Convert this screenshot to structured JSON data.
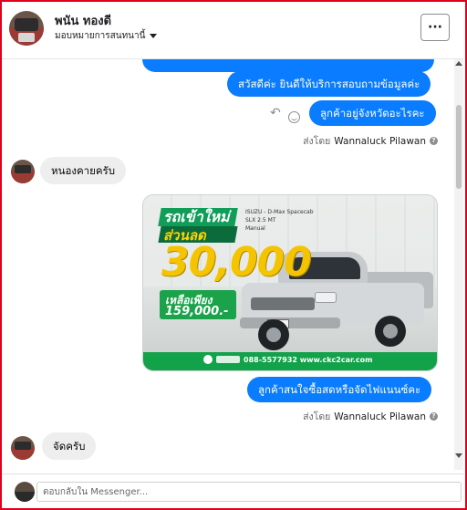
{
  "header": {
    "name": "พนัน ทองดี",
    "subtitle": "มอบหมายการสนทนานี้"
  },
  "messages": {
    "out1": "สวัสดีค่ะ  ยินดีให้บริการสอบถามข้อมูลค่ะ",
    "out2": "ลูกค้าอยู่จังหวัดอะไรคะ",
    "sent_by_prefix": "ส่งโดย",
    "sent_by_name": "Wannaluck Pilawan",
    "in1": "หนองคายครับ",
    "out3": "ลูกค้าสนใจซื้อสดหรือจัดไฟแนนซ์คะ",
    "in2": "จัดครับ"
  },
  "ad": {
    "title1": "รถเข้าใหม่",
    "title2": "ส่วนลด",
    "discount": "30,000",
    "model_line1": "ISUZU - D-Max Spacecab",
    "model_line2": "SLX 2.5 MT",
    "model_line3": "Manual",
    "remain_label": "เหลือเพียง",
    "price": "159,000.-",
    "footer": "088-5577932  www.ckc2car.com"
  },
  "composer": {
    "placeholder": "ตอบกลับใน Messenger..."
  },
  "icons": [
    "more-icon",
    "caret-down-icon",
    "reply-icon",
    "emoji-icon",
    "help-icon"
  ],
  "colors": {
    "outgoing_bubble": "#0a7cff",
    "incoming_bubble": "#eeeeef",
    "frame_border": "#e0001b"
  }
}
